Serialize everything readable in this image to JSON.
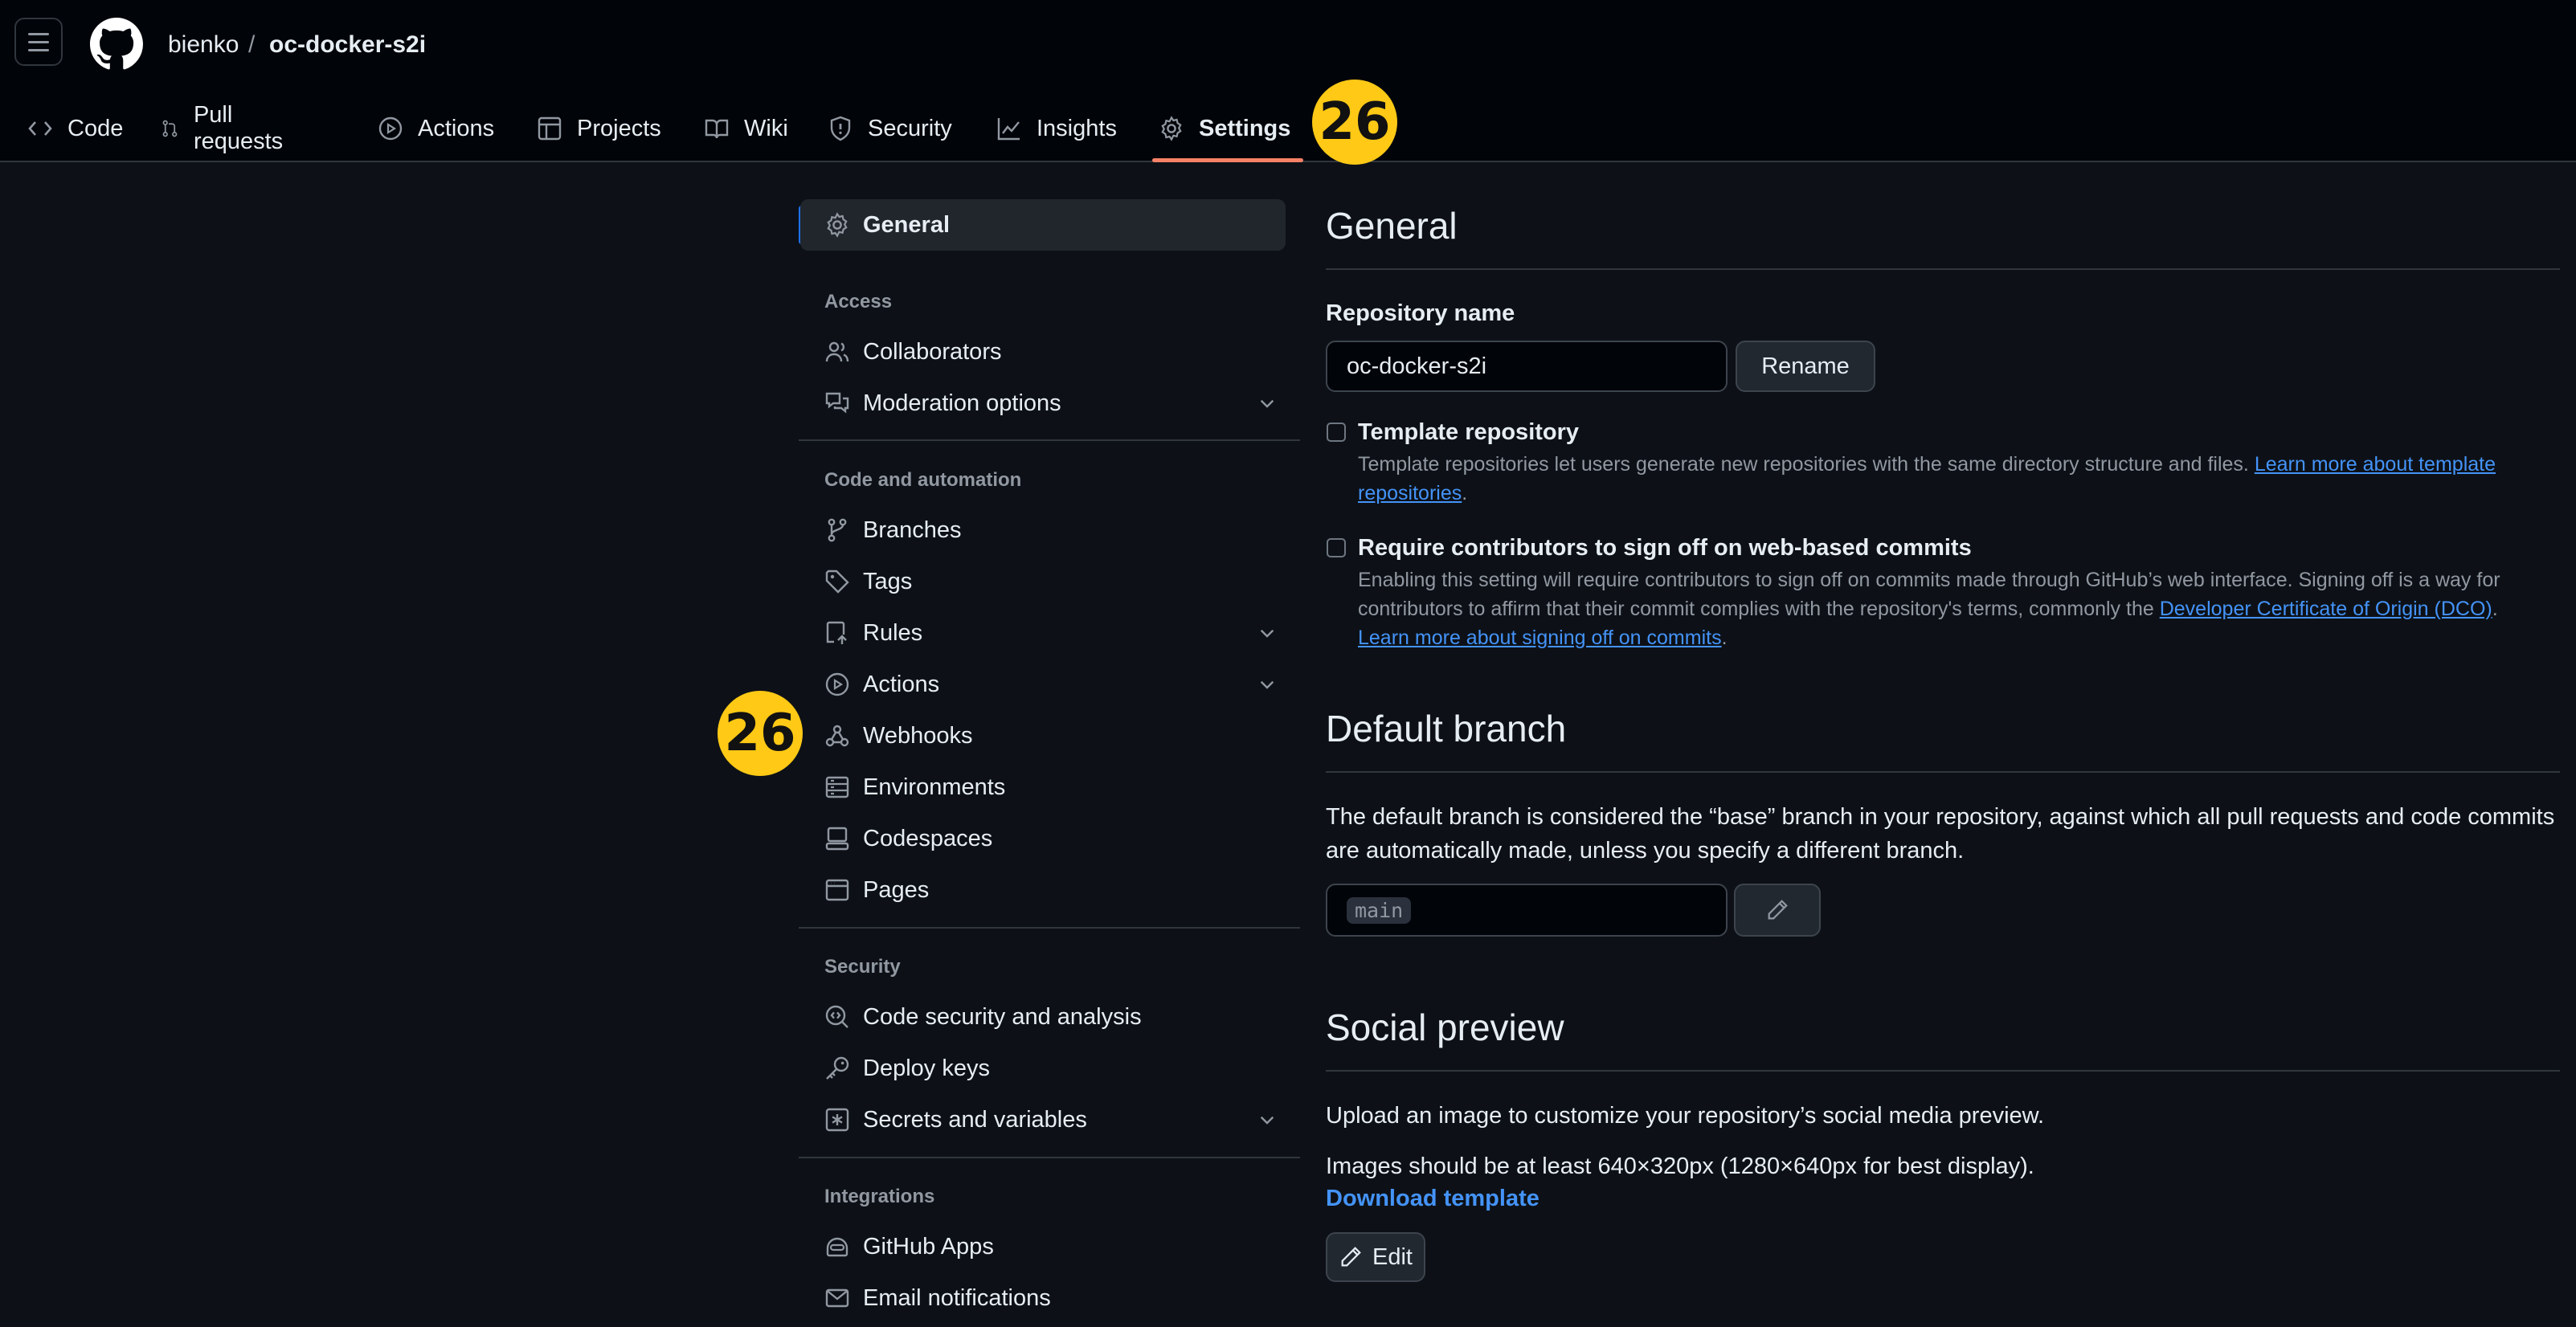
{
  "header": {
    "owner": "bienko",
    "separator": "/",
    "repo": "oc-docker-s2i"
  },
  "tabs": [
    {
      "label": "Code",
      "icon": "code-icon"
    },
    {
      "label": "Pull requests",
      "icon": "git-pull-request-icon"
    },
    {
      "label": "Actions",
      "icon": "play-icon"
    },
    {
      "label": "Projects",
      "icon": "table-icon"
    },
    {
      "label": "Wiki",
      "icon": "book-icon"
    },
    {
      "label": "Security",
      "icon": "shield-icon"
    },
    {
      "label": "Insights",
      "icon": "graph-icon"
    },
    {
      "label": "Settings",
      "icon": "gear-icon",
      "active": true
    }
  ],
  "badges": {
    "top": "26",
    "side": "26"
  },
  "sidebar": {
    "general": "General",
    "groups": {
      "access": "Access",
      "code_automation": "Code and automation",
      "security": "Security",
      "integrations": "Integrations"
    },
    "items": {
      "collaborators": "Collaborators",
      "moderation": "Moderation options",
      "branches": "Branches",
      "tags": "Tags",
      "rules": "Rules",
      "actions": "Actions",
      "webhooks": "Webhooks",
      "environments": "Environments",
      "codespaces": "Codespaces",
      "pages": "Pages",
      "code_security": "Code security and analysis",
      "deploy_keys": "Deploy keys",
      "secrets": "Secrets and variables",
      "github_apps": "GitHub Apps",
      "email_notifications": "Email notifications"
    }
  },
  "main": {
    "title": "General",
    "repo_name_label": "Repository name",
    "repo_name_value": "oc-docker-s2i",
    "rename_button": "Rename",
    "template": {
      "label": "Template repository",
      "desc": "Template repositories let users generate new repositories with the same directory structure and files.",
      "link": "Learn more about template repositories",
      "checked": false
    },
    "signoff": {
      "label": "Require contributors to sign off on web-based commits",
      "desc": "Enabling this setting will require contributors to sign off on commits made through GitHub’s web interface. Signing off is a way for contributors to affirm that their commit complies with the repository's terms, commonly the",
      "link1": "Developer Certificate of Origin (DCO)",
      "link2": "Learn more about signing off on commits",
      "checked": false
    },
    "default_branch": {
      "title": "Default branch",
      "desc": "The default branch is considered the “base” branch in your repository, against which all pull requests and code commits are automatically made, unless you specify a different branch.",
      "value": "main"
    },
    "social": {
      "title": "Social preview",
      "desc": "Upload an image to customize your repository’s social media preview.",
      "size_note": "Images should be at least 640×320px (1280×640px for best display).",
      "download": "Download template",
      "edit": "Edit"
    }
  },
  "colors": {
    "accent": "#1f6feb",
    "tab_underline": "#f78166",
    "badge": "#ffc915",
    "link": "#4493f8"
  }
}
